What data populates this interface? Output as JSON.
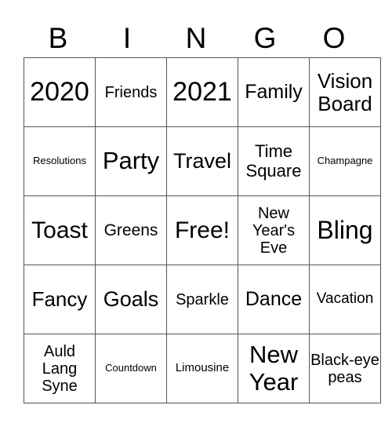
{
  "header": [
    "B",
    "I",
    "N",
    "G",
    "O"
  ],
  "cells": [
    [
      {
        "text": "2020",
        "size": 34
      },
      {
        "text": "Friends",
        "size": 20
      },
      {
        "text": "2021",
        "size": 34
      },
      {
        "text": "Family",
        "size": 25
      },
      {
        "text": "Vision Board",
        "size": 26
      }
    ],
    [
      {
        "text": "Resolutions",
        "size": 13
      },
      {
        "text": "Party",
        "size": 31
      },
      {
        "text": "Travel",
        "size": 27
      },
      {
        "text": "Time Square",
        "size": 22
      },
      {
        "text": "Champagne",
        "size": 13
      }
    ],
    [
      {
        "text": "Toast",
        "size": 30
      },
      {
        "text": "Greens",
        "size": 21
      },
      {
        "text": "Free!",
        "size": 30
      },
      {
        "text": "New Year's Eve",
        "size": 20
      },
      {
        "text": "Bling",
        "size": 32
      }
    ],
    [
      {
        "text": "Fancy",
        "size": 26
      },
      {
        "text": "Goals",
        "size": 27
      },
      {
        "text": "Sparkle",
        "size": 20
      },
      {
        "text": "Dance",
        "size": 25
      },
      {
        "text": "Vacation",
        "size": 19
      }
    ],
    [
      {
        "text": "Auld Lang Syne",
        "size": 20
      },
      {
        "text": "Countdown",
        "size": 13
      },
      {
        "text": "Limousine",
        "size": 15
      },
      {
        "text": "New Year",
        "size": 31
      },
      {
        "text": "Black-eye peas",
        "size": 20
      }
    ]
  ]
}
